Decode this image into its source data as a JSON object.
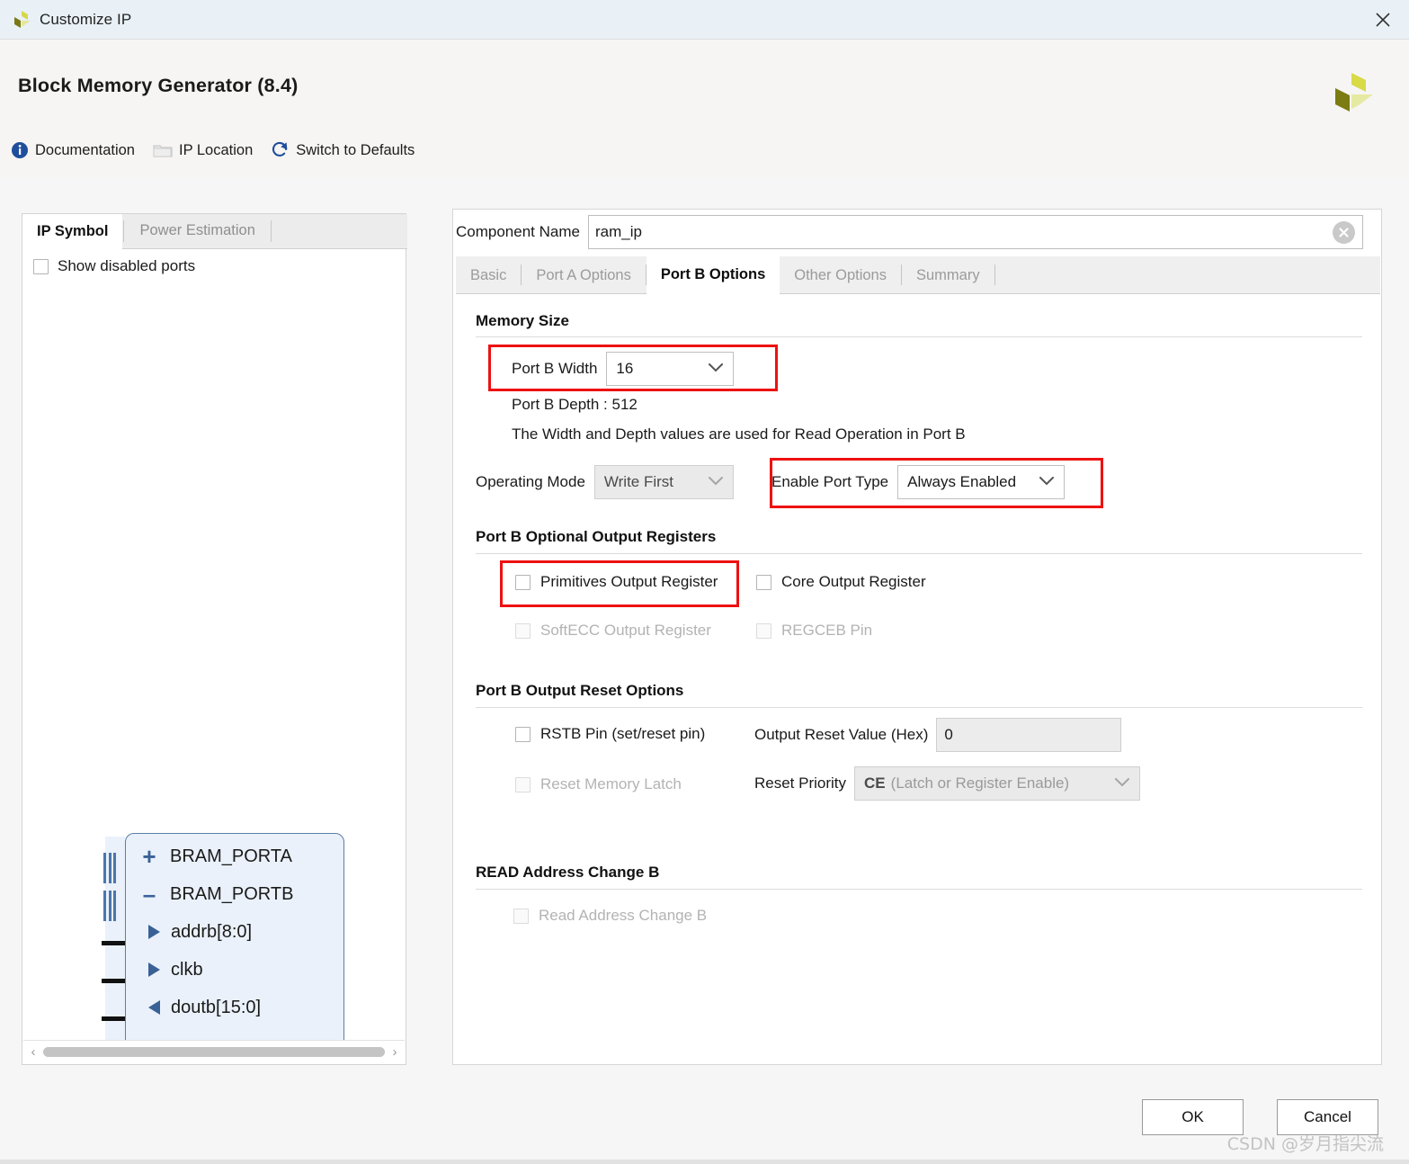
{
  "window": {
    "title": "Customize IP",
    "close_icon": "close-icon",
    "logo_icon": "xilinx-logo-icon"
  },
  "header": {
    "title": "Block Memory Generator (8.4)",
    "toolbar": [
      {
        "label": "Documentation",
        "icon": "info-icon"
      },
      {
        "label": "IP Location",
        "icon": "folder-icon"
      },
      {
        "label": "Switch to Defaults",
        "icon": "refresh-icon"
      }
    ]
  },
  "left_panel": {
    "tabs": [
      {
        "label": "IP Symbol",
        "active": true
      },
      {
        "label": "Power Estimation",
        "active": false
      }
    ],
    "show_disabled_ports": {
      "label": "Show disabled ports",
      "checked": false
    },
    "symbol": {
      "ports": [
        {
          "label": "BRAM_PORTA",
          "marker": "+",
          "kind": "bus"
        },
        {
          "label": "BRAM_PORTB",
          "marker": "–",
          "kind": "bus"
        },
        {
          "label": "addrb[8:0]",
          "marker": "input-arrow",
          "kind": "input"
        },
        {
          "label": "clkb",
          "marker": "input-arrow",
          "kind": "input"
        },
        {
          "label": "doutb[15:0]",
          "marker": "output-arrow",
          "kind": "output"
        }
      ]
    }
  },
  "main": {
    "component_name": {
      "label": "Component Name",
      "value": "ram_ip",
      "placeholder": ""
    },
    "tabs": [
      {
        "label": "Basic",
        "active": false
      },
      {
        "label": "Port A Options",
        "active": false
      },
      {
        "label": "Port B Options",
        "active": true
      },
      {
        "label": "Other Options",
        "active": false
      },
      {
        "label": "Summary",
        "active": false
      }
    ],
    "memory_size": {
      "section_title": "Memory Size",
      "port_b_width": {
        "label": "Port B Width",
        "value": "16",
        "enabled": true,
        "highlighted": true
      },
      "port_b_depth": "Port B Depth : 512",
      "note": "The Width and Depth values are used for Read Operation in Port B",
      "operating_mode": {
        "label": "Operating Mode",
        "value": "Write First",
        "enabled": false
      },
      "enable_port_type": {
        "label": "Enable Port Type",
        "value": "Always Enabled",
        "enabled": true,
        "highlighted": true
      }
    },
    "optional_output_registers": {
      "section_title": "Port B Optional Output Registers",
      "items": [
        {
          "label": "Primitives Output Register",
          "checked": false,
          "enabled": true,
          "highlighted": true
        },
        {
          "label": "Core Output Register",
          "checked": false,
          "enabled": true,
          "highlighted": false
        },
        {
          "label": "SoftECC Output Register",
          "checked": false,
          "enabled": false,
          "highlighted": false
        },
        {
          "label": "REGCEB Pin",
          "checked": false,
          "enabled": false,
          "highlighted": false
        }
      ]
    },
    "output_reset_options": {
      "section_title": "Port B Output Reset Options",
      "rstb_pin": {
        "label": "RSTB Pin (set/reset pin)",
        "checked": false,
        "enabled": true
      },
      "reset_memory_latch": {
        "label": "Reset Memory Latch",
        "checked": false,
        "enabled": false
      },
      "output_reset_value": {
        "label": "Output Reset Value (Hex)",
        "value": "0",
        "enabled": false
      },
      "reset_priority": {
        "label": "Reset Priority",
        "value_strong": "CE",
        "value_dim": "(Latch or Register Enable)",
        "enabled": false
      }
    },
    "read_address_change": {
      "section_title": "READ Address Change B",
      "checkbox": {
        "label": "Read Address Change B",
        "checked": false,
        "enabled": false
      }
    }
  },
  "footer": {
    "ok_label": "OK",
    "cancel_label": "Cancel",
    "watermark": "CSDN @岁月指尖流"
  },
  "colors": {
    "titlebar_bg": "#e9f1f6",
    "highlight_red": "#ee1111",
    "symbol_fill": "#eaf1fa",
    "symbol_stroke": "#5b7ea8",
    "accent_blue": "#3a6196"
  }
}
